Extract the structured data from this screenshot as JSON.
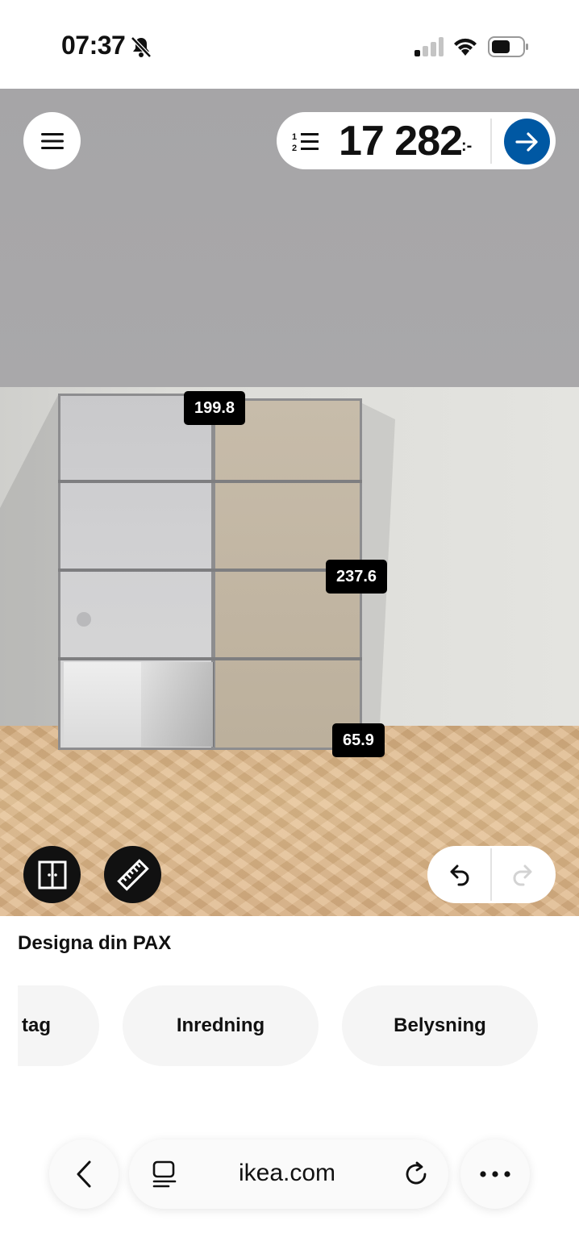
{
  "status_bar": {
    "time": "07:37",
    "icons": [
      "bell-slash-icon",
      "signal-icon",
      "wifi-icon",
      "battery-icon"
    ]
  },
  "planner": {
    "menu_icon": "hamburger-menu-icon",
    "price": {
      "list_icon": "numbered-list-icon",
      "amount": "17 282",
      "suffix": ":-",
      "go_icon": "arrow-right-icon",
      "accent": "#0058a3"
    },
    "measurements": {
      "width": "199.8",
      "height": "237.6",
      "depth": "65.9"
    },
    "tools": {
      "doors_icon": "wardrobe-doors-icon",
      "measure_icon": "ruler-icon",
      "undo_icon": "undo-icon",
      "redo_icon": "redo-icon"
    }
  },
  "section": {
    "title": "Designa din PAX",
    "chips": [
      "tag",
      "Inredning",
      "Belysning"
    ]
  },
  "browser": {
    "back_icon": "chevron-left-icon",
    "tabs_icon": "tabs-icon",
    "url": "ikea.com",
    "reload_icon": "reload-icon",
    "more_icon": "more-dots-icon"
  }
}
